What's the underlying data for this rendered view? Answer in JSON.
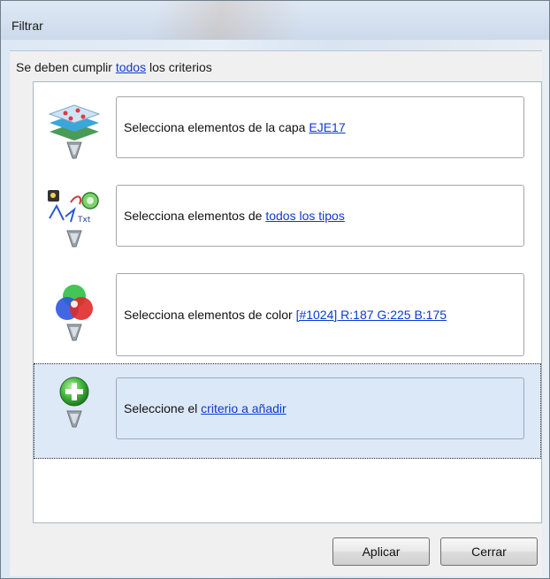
{
  "window": {
    "title": "Filtrar"
  },
  "header": {
    "prefix": "Se deben cumplir ",
    "link": "todos",
    "suffix": " los criterios"
  },
  "criteria": [
    {
      "icon": "layers-filter-icon",
      "text": "Selecciona elementos de la capa ",
      "link": "EJE17"
    },
    {
      "icon": "element-types-filter-icon",
      "text": "Selecciona elementos de ",
      "link": "todos los tipos"
    },
    {
      "icon": "rgb-color-filter-icon",
      "text": "Selecciona elementos de color ",
      "link": "[#1024] R:187 G:225 B:175"
    },
    {
      "icon": "add-criterion-icon",
      "text": "Seleccione el ",
      "link": "criterio a añadir"
    }
  ],
  "buttons": {
    "apply": "Aplicar",
    "close": "Cerrar"
  },
  "colors": {
    "link": "#0a3bd2",
    "selected_row": "#dde9f7"
  }
}
